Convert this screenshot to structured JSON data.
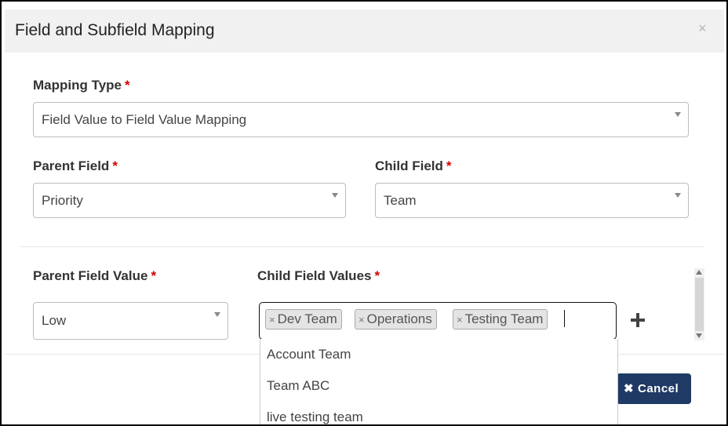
{
  "modal": {
    "title": "Field and Subfield Mapping",
    "close_symbol": "×"
  },
  "form": {
    "required_marker": "*",
    "mapping_type": {
      "label": "Mapping Type",
      "value": "Field Value to Field Value Mapping"
    },
    "parent_field": {
      "label": "Parent Field",
      "value": "Priority"
    },
    "child_field": {
      "label": "Child Field",
      "value": "Team"
    },
    "parent_field_value": {
      "label": "Parent Field Value",
      "value": "Low"
    },
    "child_field_values": {
      "label": "Child Field Values",
      "remove_symbol": "×",
      "tags": [
        "Dev Team",
        "Operations",
        "Testing Team"
      ]
    }
  },
  "dropdown": {
    "options": [
      "Account Team",
      "Team ABC",
      "live testing team"
    ]
  },
  "footer": {
    "cancel_icon": "✖",
    "cancel_label": "Cancel"
  },
  "icons": [
    "close-icon",
    "chevron-down-icon",
    "plus-icon",
    "remove-tag-icon",
    "times-icon"
  ],
  "colors": {
    "required": "#d40000",
    "cancel_button": "#1f3a64"
  }
}
